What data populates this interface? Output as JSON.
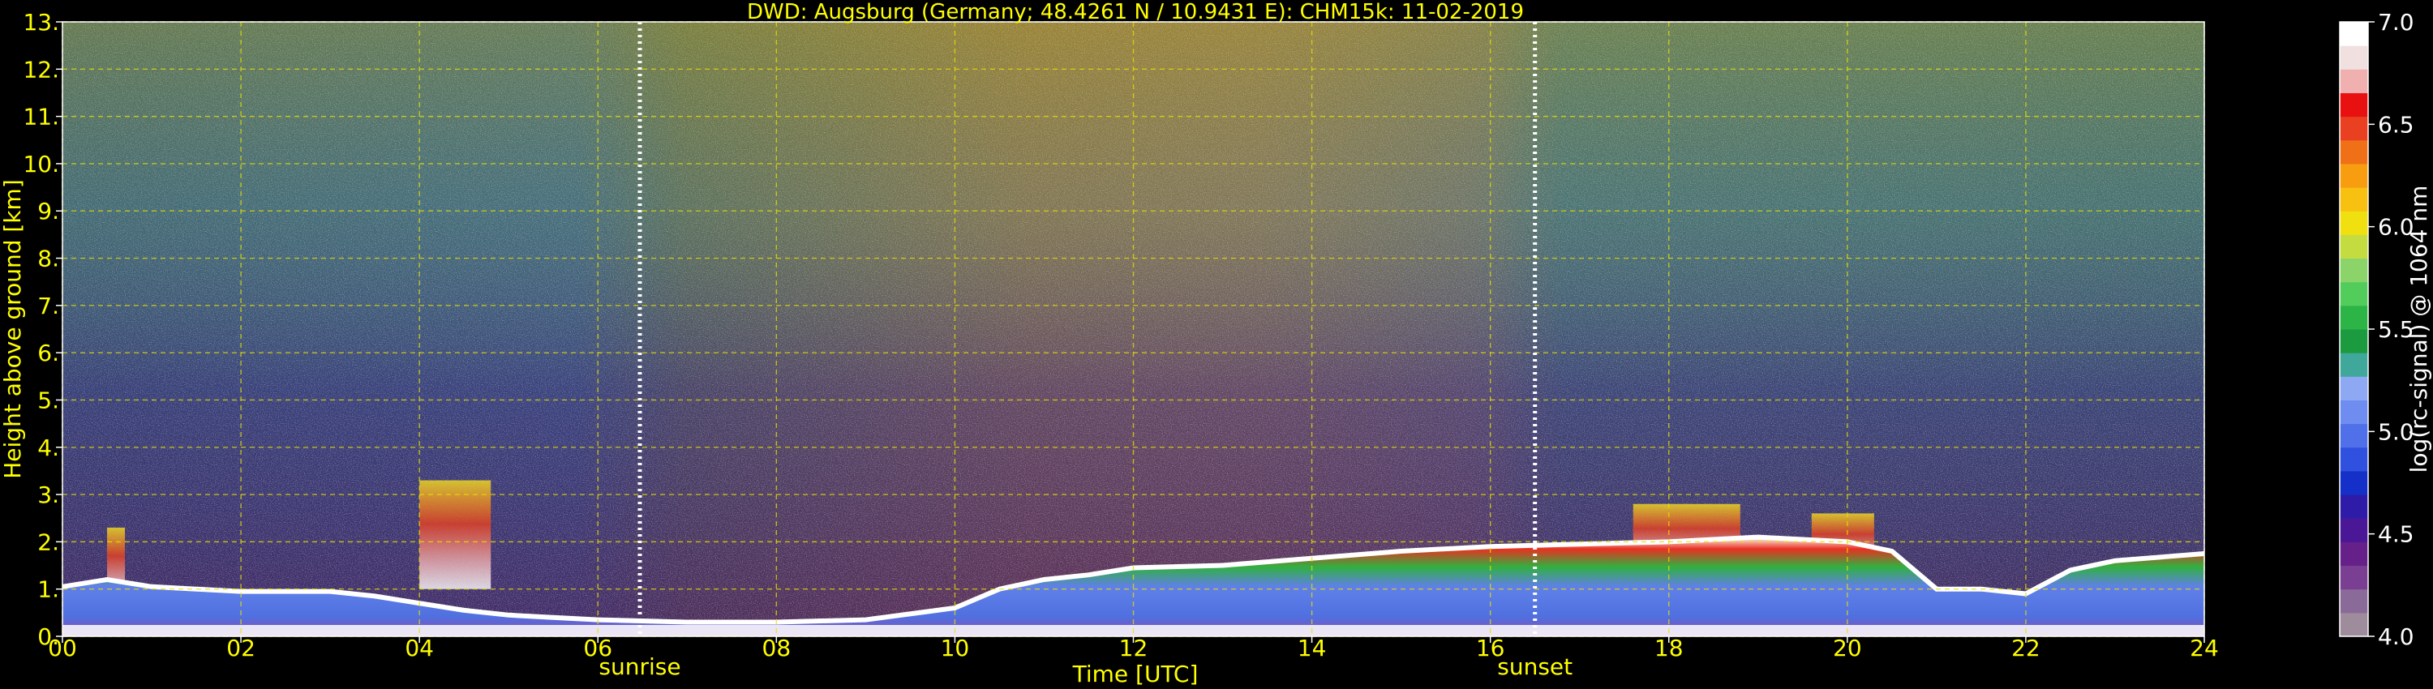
{
  "chart_data": {
    "type": "heatmap",
    "title": "DWD: Augsburg (Germany; 48.4261 N / 10.9431 E):    CHM15k: 11-02-2019",
    "xlabel": "Time [UTC]",
    "ylabel": "Height above ground [km]",
    "xlim": [
      0,
      24
    ],
    "ylim": [
      0,
      13
    ],
    "xticks": [
      "00",
      "02",
      "04",
      "06",
      "08",
      "10",
      "12",
      "14",
      "16",
      "18",
      "20",
      "22",
      "24"
    ],
    "yticks": [
      "0.",
      "1.",
      "2.",
      "3.",
      "4.",
      "5.",
      "6.",
      "7.",
      "8.",
      "9.",
      "10.",
      "11.",
      "12.",
      "13."
    ],
    "grid": true,
    "annotations": [
      {
        "label": "sunrise",
        "x": 6.47
      },
      {
        "label": "sunset",
        "x": 16.5
      }
    ],
    "colorbar": {
      "label": "log(rc-signal) @ 1064 nm",
      "range": [
        4.0,
        7.0
      ],
      "ticks": [
        "4.0",
        "4.5",
        "5.0",
        "5.5",
        "6.0",
        "6.5",
        "7.0"
      ],
      "colors": [
        "#9e8c9c",
        "#8a6a98",
        "#7a3f92",
        "#66208a",
        "#4a1896",
        "#2e1ca8",
        "#1530c8",
        "#3050e0",
        "#4f70e8",
        "#6f8df0",
        "#8fa8f4",
        "#3fa89a",
        "#1c9a40",
        "#2db446",
        "#52cc5a",
        "#8ad46a",
        "#c4dc40",
        "#f0e010",
        "#f8c010",
        "#f89c10",
        "#f07018",
        "#e84020",
        "#e81010",
        "#f0b0b0",
        "#f0e0e0",
        "#ffffff"
      ]
    },
    "aerosol_layer_top_km": [
      [
        0,
        1.05
      ],
      [
        0.5,
        1.2
      ],
      [
        1,
        1.05
      ],
      [
        1.5,
        1.0
      ],
      [
        2,
        0.95
      ],
      [
        2.5,
        0.95
      ],
      [
        3,
        0.95
      ],
      [
        3.5,
        0.85
      ],
      [
        4,
        0.7
      ],
      [
        4.5,
        0.55
      ],
      [
        5,
        0.45
      ],
      [
        5.5,
        0.4
      ],
      [
        6,
        0.35
      ],
      [
        7,
        0.3
      ],
      [
        8,
        0.3
      ],
      [
        9,
        0.35
      ],
      [
        10,
        0.6
      ],
      [
        10.5,
        1.0
      ],
      [
        11,
        1.2
      ],
      [
        11.5,
        1.3
      ],
      [
        12,
        1.45
      ],
      [
        13,
        1.5
      ],
      [
        14,
        1.65
      ],
      [
        15,
        1.8
      ],
      [
        16,
        1.9
      ],
      [
        17,
        1.95
      ],
      [
        18,
        2.0
      ],
      [
        19,
        2.1
      ],
      [
        20,
        2.0
      ],
      [
        20.5,
        1.8
      ],
      [
        21,
        1.0
      ],
      [
        21.5,
        1.0
      ],
      [
        22,
        0.9
      ],
      [
        22.5,
        1.4
      ],
      [
        23,
        1.6
      ],
      [
        24,
        1.75
      ]
    ],
    "plumes": [
      {
        "x": [
          4.0,
          4.8
        ],
        "height_km": [
          1.0,
          3.3
        ]
      },
      {
        "x": [
          0.5,
          0.7
        ],
        "height_km": [
          0.8,
          2.3
        ]
      },
      {
        "x": [
          17.6,
          18.8
        ],
        "height_km": [
          1.5,
          2.8
        ]
      },
      {
        "x": [
          19.6,
          20.3
        ],
        "height_km": [
          1.5,
          2.6
        ]
      }
    ]
  }
}
